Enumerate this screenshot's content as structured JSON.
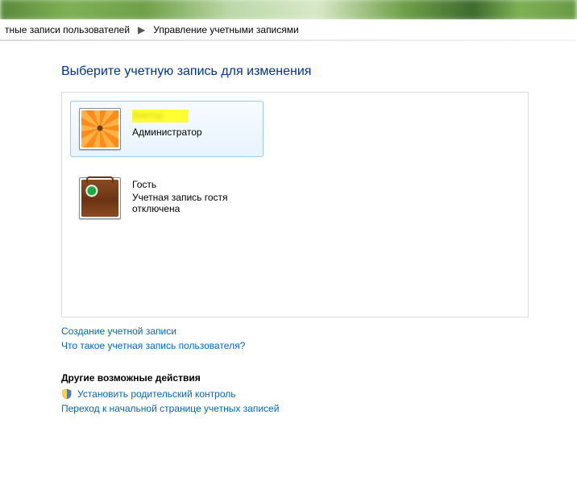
{
  "breadcrumb": {
    "level1_fragment": "тные записи пользователей",
    "level2": "Управление учетными записями"
  },
  "page": {
    "title": "Выберите учетную запись для изменения"
  },
  "accounts": [
    {
      "name": "Виктор",
      "role": "Администратор",
      "icon": "flower",
      "selected": true,
      "redacted": true
    },
    {
      "name": "Гость",
      "role": "Учетная запись гостя отключена",
      "icon": "suitcase",
      "selected": false,
      "redacted": false
    }
  ],
  "links": {
    "create_account": "Создание учетной записи",
    "what_is_account": "Что такое учетная запись пользователя?"
  },
  "other": {
    "heading": "Другие возможные действия",
    "parental": "Установить родительский контроль",
    "goto_main": "Переход к начальной странице учетных записей"
  }
}
